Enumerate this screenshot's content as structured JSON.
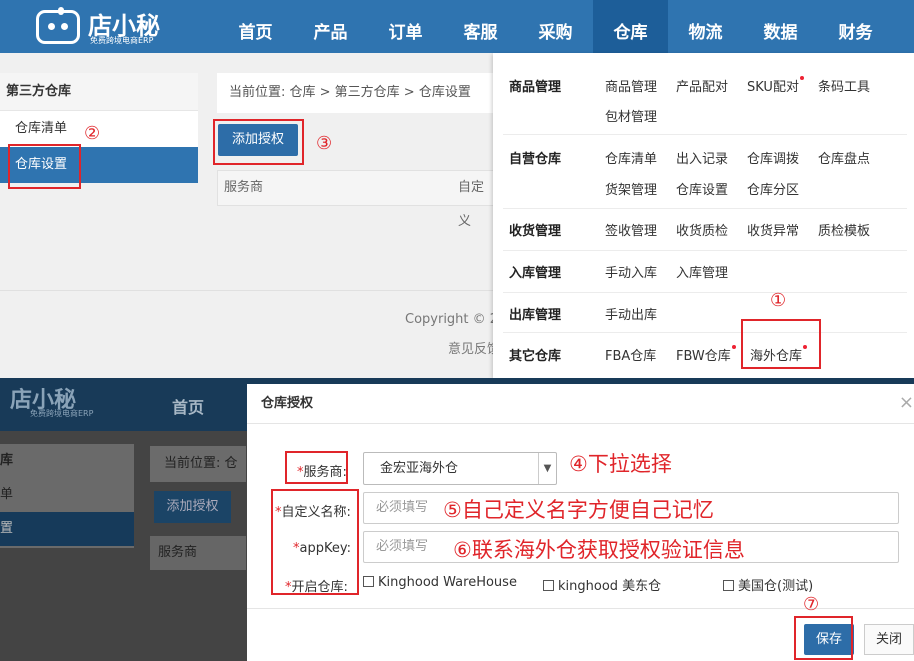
{
  "top": {
    "brand": "店小秘",
    "slogan": "免费跨境电商ERP",
    "nav": [
      "首页",
      "产品",
      "订单",
      "客服",
      "采购",
      "仓库",
      "物流",
      "数据",
      "财务"
    ],
    "nav_active": "仓库",
    "sidebar": {
      "title": "第三方仓库",
      "items": [
        "仓库清单",
        "仓库设置"
      ],
      "selected": "仓库设置"
    },
    "breadcrumb": "当前位置:  仓库 > 第三方仓库 > 仓库设置",
    "add_button": "添加授权",
    "table_headers": [
      "服务商",
      "自定义"
    ],
    "copyright": "Copyright  ©  2",
    "feedback": "意见反馈",
    "mega_menu": [
      {
        "title": "商品管理",
        "links": [
          "商品管理",
          "产品配对",
          "SKU配对",
          "条码工具",
          "包材管理"
        ]
      },
      {
        "title": "自营仓库",
        "links": [
          "仓库清单",
          "出入记录",
          "仓库调拨",
          "仓库盘点",
          "货架管理",
          "仓库设置",
          "仓库分区"
        ]
      },
      {
        "title": "收货管理",
        "links": [
          "签收管理",
          "收货质检",
          "收货异常",
          "质检模板"
        ]
      },
      {
        "title": "入库管理",
        "links": [
          "手动入库",
          "入库管理"
        ]
      },
      {
        "title": "出库管理",
        "links": [
          "手动出库"
        ]
      },
      {
        "title": "其它仓库",
        "links": [
          "FBA仓库",
          "FBW仓库",
          "海外仓库"
        ]
      }
    ],
    "markers": {
      "m1": "①",
      "m2": "②",
      "m3": "③"
    }
  },
  "bottom": {
    "brand": "店小秘",
    "slogan": "免费跨境电商ERP",
    "home": "首页",
    "sidebar": [
      "库",
      "单",
      "置"
    ],
    "breadcrumb": "当前位置:  仓",
    "add_button": "添加授权",
    "table_header": "服务商",
    "modal": {
      "title": "仓库授权",
      "close": "×",
      "provider_label": "服务商:",
      "provider_value": "金宏亚海外仓",
      "name_label": "自定义名称:",
      "name_placeholder": "必须填写",
      "appkey_label": "appKey:",
      "appkey_placeholder": "必须填写",
      "warehouse_label": "开启仓库:",
      "warehouses": [
        "Kinghood WareHouse",
        "kinghood 美东仓",
        "美国仓(测试)"
      ],
      "required_mark": "*",
      "save": "保存",
      "close_btn": "关闭"
    },
    "annotations": {
      "a4": "④下拉选择",
      "a5": "⑤自己定义名字方便自己记忆",
      "a6": "⑥联系海外仓获取授权验证信息",
      "m7": "⑦"
    }
  },
  "colors": {
    "primary": "#2f74b0",
    "annotation_red": "#e0252a"
  }
}
